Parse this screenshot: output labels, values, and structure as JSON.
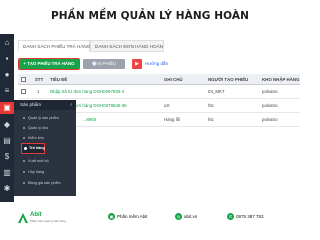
{
  "title": "PHẦN MỀM QUẢN LÝ HÀNG HOÀN",
  "tabs": [
    "DANH SÁCH PHIẾU TRẢ HÀNG",
    "DANH SÁCH ĐƠN HÀNG HOÀN"
  ],
  "toolbar": {
    "create_label": "+ TẠO PHIẾU TRẢ HÀNG",
    "print_label": "🖶 IN PHIẾU",
    "video_icon": "youtube-icon",
    "help_label": "Hướng dẫn"
  },
  "table": {
    "columns": [
      "STT",
      "TIÊU ĐỀ",
      "GHI CHÚ",
      "NGƯỜI TẠO PHIẾU",
      "KHO NHẬP HÀNG"
    ],
    "rows": [
      {
        "stt": "1",
        "title": "Nhập trả từ đơn hàng DGH0097935-4",
        "note": "",
        "creator": "04_MKT",
        "warehouse": "polvatro"
      },
      {
        "stt": "2",
        "title": "Nhập trả từ đơn hàng DGH0079536-36",
        "note": "xzt",
        "creator": "htc",
        "warehouse": "polvatro"
      },
      {
        "stt": "3",
        "title": "…8965",
        "note": "Hàng lỗi",
        "creator": "htc",
        "warehouse": "polvatro"
      }
    ]
  },
  "menu": {
    "header": "Sản phẩm",
    "items": [
      "Quản lý sản phẩm",
      "Quản lý kho",
      "Kiểm kho",
      "Trả hàng",
      "Xuất mới bộ",
      "Hủy hàng",
      "Bảng giá sản phẩm"
    ],
    "active_index": 3
  },
  "footer": {
    "brand": "Abit",
    "brand_sub": "Phần mềm quản lý bán hàng",
    "product": "Phần mềm Abit",
    "site": "abit.vn",
    "phone": "0975 387 753"
  },
  "colors": {
    "accent": "#16a34a",
    "highlight": "#e53935",
    "sidebar": "#1f2937"
  }
}
